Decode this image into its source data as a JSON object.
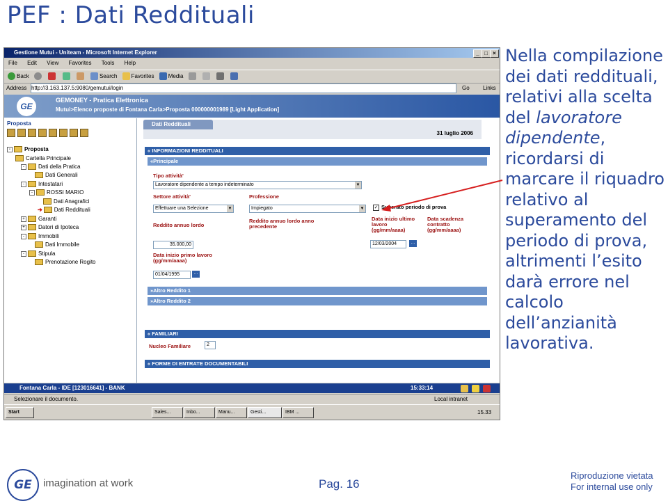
{
  "slide": {
    "title": "PEF : Dati Reddituali",
    "callout": {
      "part1": "Nella compilazione dei dati reddituali, relativi alla scelta del ",
      "italic": "lavoratore dipendente",
      "part2": ", ricordarsi di marcare il riquadro relativo al superamento del periodo di prova, altrimenti l’esito darà errore nel calcolo dell’anzianità lavorativa."
    },
    "footer": {
      "logo_text": "GE",
      "tagline": "imagination at work",
      "page": "Pag. 16",
      "rights_line1": "Riproduzione vietata",
      "rights_line2": "For internal use only"
    }
  },
  "browser": {
    "window_title": "Gestione Mutui - Uniteam - Microsoft Internet Explorer",
    "window_buttons": [
      "_",
      "□",
      "×"
    ],
    "menu": [
      "File",
      "Edit",
      "View",
      "Favorites",
      "Tools",
      "Help"
    ],
    "toolbar": {
      "back": "Back",
      "search": "Search",
      "favorites": "Favorites",
      "media": "Media"
    },
    "address_label": "Address",
    "url": "http://3.163.137.5:9080/gemutui/login",
    "go": "Go",
    "links": "Links",
    "status_text": "Selezionare il documento.",
    "zone": "Local intranet"
  },
  "app": {
    "title": "GEMONEY - Pratica Elettronica",
    "breadcrumb": "Mutui>Elenco proposte di Fontana Carla>Proposta 000000001989 [Light Application]",
    "logo_text": "GE",
    "left_title": "Proposta",
    "tree": [
      {
        "label": "Proposta",
        "bold": true
      },
      {
        "label": "Cartella Principale"
      },
      {
        "label": "Dati della Pratica"
      },
      {
        "label": "Dati Generali"
      },
      {
        "label": "Intestatari"
      },
      {
        "label": "ROSSI MARIO"
      },
      {
        "label": "Dati Anagrafici"
      },
      {
        "label": "Dati Reddituali"
      },
      {
        "label": "Garanti"
      },
      {
        "label": "Datori di Ipoteca"
      },
      {
        "label": "Immobili"
      },
      {
        "label": "Dati Immobile"
      },
      {
        "label": "Stipula"
      },
      {
        "label": "Prenotazione Rogito"
      }
    ],
    "tab": "Dati Reddituali",
    "date": "31 luglio 2006",
    "section_info": "« INFORMAZIONI REDDITUALI",
    "sub_principale": "«Principale",
    "tipo_attivita_label": "Tipo attività'",
    "tipo_attivita_value": "Lavoratore dipendente a tempo indeterminato",
    "settore_label": "Settore attività'",
    "settore_value": "Effettuare una Selezione",
    "professione_label": "Professione",
    "professione_value": "Impiegato",
    "prova_label": "Superato periodo di prova",
    "reddito_label": "Reddito annuo lordo",
    "reddito_value": "35.000,00",
    "reddito_prec_label": "Reddito annuo lordo anno precedente",
    "data_inizio_ult_label": "Data inizio ultimo lavoro (gg/mm/aaaa)",
    "data_inizio_ult_value": "12/03/2004",
    "data_scadenza_label": "Data scadenza contratto (gg/mm/aaaa)",
    "data_inizio_primo_label": "Data inizio primo lavoro (gg/mm/aaaa)",
    "data_inizio_primo_value": "01/04/1995",
    "altro1": "»Altro Reddito 1",
    "altro2": "»Altro Reddito 2",
    "section_familiari": "« FAMILIARI",
    "nucleo_label": "Nucleo Familiare",
    "nucleo_value": "2",
    "section_forme": "« FORME DI ENTRATE DOCUMENTABILI",
    "dots": "...",
    "status_left": "Fontana Carla - IDE [123016641] - BANK",
    "status_time": "15:33:14"
  },
  "taskbar": {
    "start": "Start",
    "tasks": [
      "Sales...",
      "Inbo...",
      "Manu...",
      "Gesti...",
      "IBM ..."
    ],
    "clock": "15.33"
  },
  "colors": {
    "accent": "#2b4a9c",
    "arrow": "#d61f1f",
    "label_red": "#9b1111"
  }
}
